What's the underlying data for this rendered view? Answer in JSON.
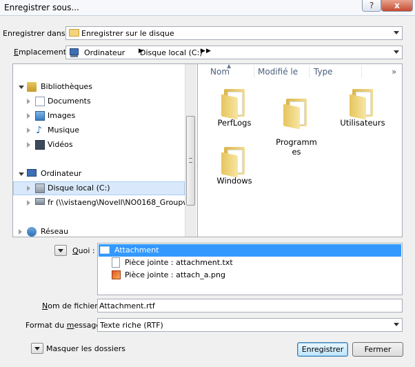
{
  "window": {
    "title": "Enregistrer sous...",
    "help_glyph": "?",
    "close_glyph": "x"
  },
  "save_in": {
    "label": "Enregistrer dans :",
    "value": "Enregistrer sur le disque"
  },
  "location": {
    "label": "Emplacement :",
    "path": [
      "Ordinateur",
      "Disque local (C:)"
    ]
  },
  "nav_tree": {
    "libraries": "Bibliothèques",
    "library_items": [
      "Documents",
      "Images",
      "Musique",
      "Vidéos"
    ],
    "computer": "Ordinateur",
    "computer_items": [
      "Disque local (C:)",
      "fr (\\\\vistaeng\\Novell\\NO0168_Groupw"
    ],
    "network": "Réseau"
  },
  "file_list": {
    "columns": [
      "Nom",
      "Modifié le",
      "Type"
    ],
    "more_glyph": "»",
    "folders": [
      {
        "name": "PerfLogs"
      },
      {
        "name": "Programm\nes"
      },
      {
        "name": "Utilisateurs"
      },
      {
        "name": "Windows"
      }
    ]
  },
  "what": {
    "label": "Quoi :",
    "items": [
      {
        "label": "Attachment",
        "selected": true
      },
      {
        "label": "Pièce jointe : attachment.txt",
        "selected": false
      },
      {
        "label": "Pièce jointe : attach_a.png",
        "selected": false
      }
    ]
  },
  "filename": {
    "label": "Nom de fichier :",
    "value": "Attachment.rtf"
  },
  "format": {
    "label": "Format du message :",
    "value": "Texte riche (RTF)"
  },
  "footer": {
    "hide_folders": "Masquer les dossiers",
    "save_button": "Enregistrer",
    "close_button": "Fermer"
  },
  "colors": {
    "accent": "#3399ff",
    "selection": "#d9e9fb",
    "folder": "#e7c55d"
  }
}
